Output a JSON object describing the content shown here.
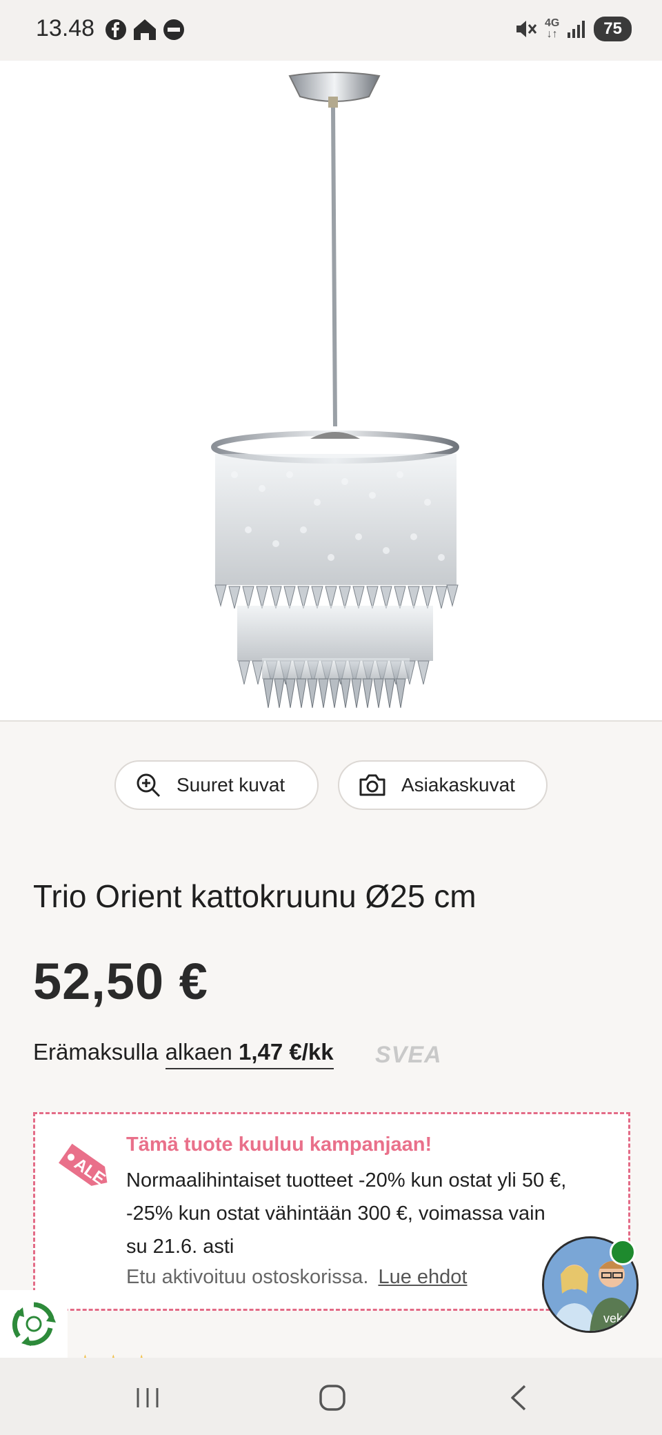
{
  "status_bar": {
    "time": "13.48",
    "network": "4G",
    "battery": "75",
    "icons": [
      "facebook-icon",
      "home-app-icon",
      "app-icon",
      "mute-icon",
      "signal-icon"
    ]
  },
  "product": {
    "image_alt": "Trio Orient kattokruunu",
    "buttons": {
      "large_images": "Suuret kuvat",
      "customer_images": "Asiakaskuvat"
    },
    "title": "Trio Orient kattokruunu Ø25 cm",
    "price": "52,50 €",
    "installment": {
      "prefix": "Erämaksulla",
      "link_text": "alkaen",
      "amount": "1,47 €/kk",
      "provider": "SVEA"
    }
  },
  "campaign": {
    "tag": "ALE",
    "title": "Tämä tuote kuuluu kampanjaan!",
    "body": "Normaalihintaiset tuotteet -20% kun ostat yli 50 €, -25% kun ostat vähintään 300 €, voimassa vain su 21.6. asti",
    "note": "Etu aktivoituu ostoskorissa.",
    "terms_link": "Lue ehdot"
  },
  "chat": {
    "label": "veke"
  },
  "colors": {
    "accent_pink": "#e9708a",
    "online_green": "#1e8a2e"
  }
}
